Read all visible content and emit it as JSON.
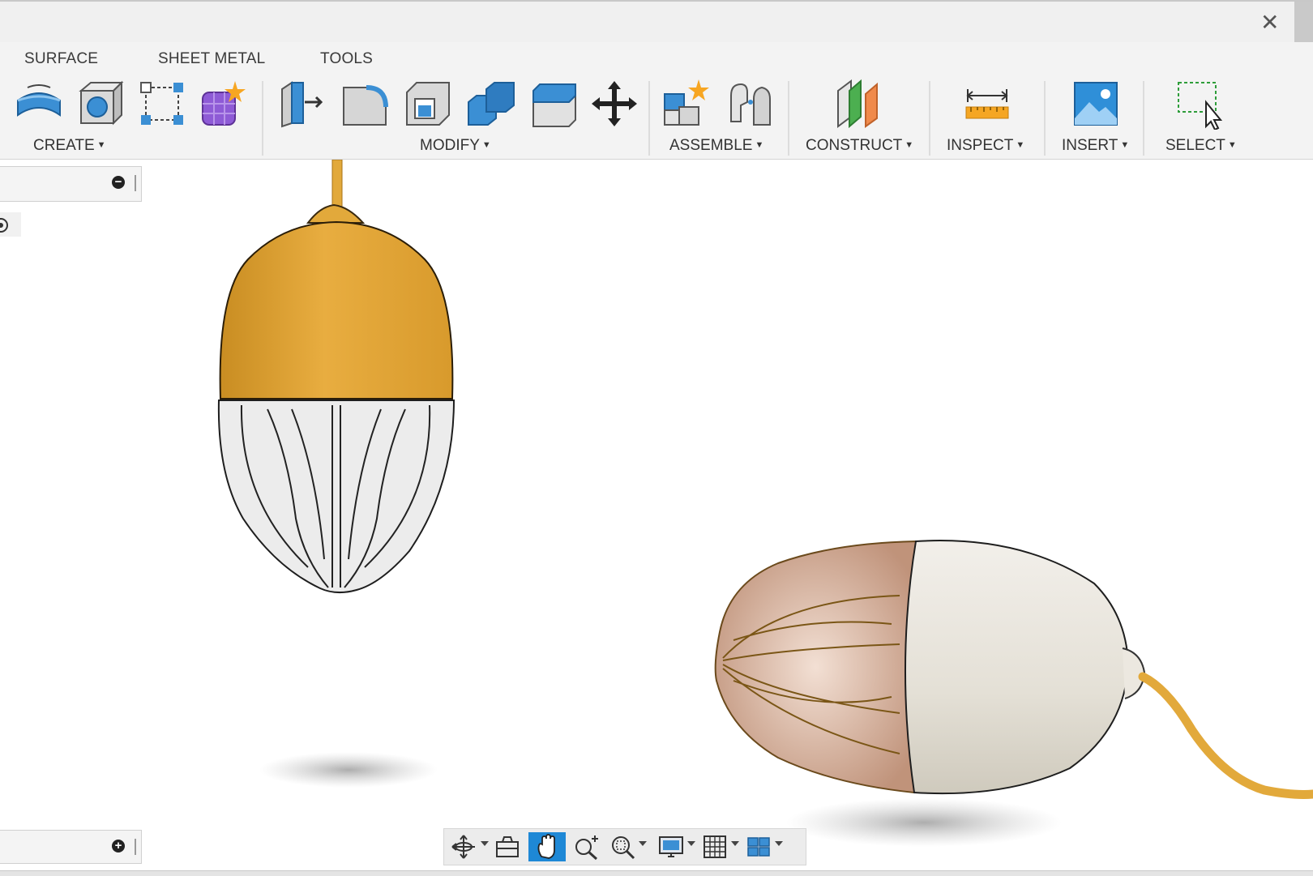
{
  "tabs": {
    "surface": "SURFACE",
    "sheet_metal": "SHEET METAL",
    "tools": "TOOLS"
  },
  "groups": {
    "create": "CREATE",
    "modify": "MODIFY",
    "assemble": "ASSEMBLE",
    "construct": "CONSTRUCT",
    "inspect": "INSPECT",
    "insert": "INSERT",
    "select": "SELECT"
  },
  "window": {
    "close_glyph": "✕"
  },
  "panels": {
    "browser_toggle": "−",
    "comments_toggle": "+"
  },
  "icons": {
    "create": [
      "extrude-surface-icon",
      "revolve-box-icon",
      "sketch-points-icon",
      "form-box-icon"
    ],
    "modify": [
      "press-pull-icon",
      "fillet-icon",
      "shell-icon",
      "combine-icon",
      "offset-face-icon",
      "move-icon"
    ],
    "assemble": [
      "new-component-icon",
      "joint-icon"
    ],
    "construct": [
      "offset-plane-icon"
    ],
    "inspect": [
      "measure-icon"
    ],
    "insert": [
      "insert-image-icon"
    ],
    "select": [
      "window-select-icon"
    ],
    "nav": [
      "orbit-icon",
      "look-at-icon",
      "pan-icon",
      "zoom-icon",
      "fit-icon",
      "display-settings-icon",
      "grid-icon",
      "viewports-icon"
    ]
  },
  "colors": {
    "accent_blue": "#1e88d6",
    "lamp_yellow": "#e2a93b",
    "lamp_cream": "#e9e6df",
    "glass_amber": "#c8a08a"
  }
}
